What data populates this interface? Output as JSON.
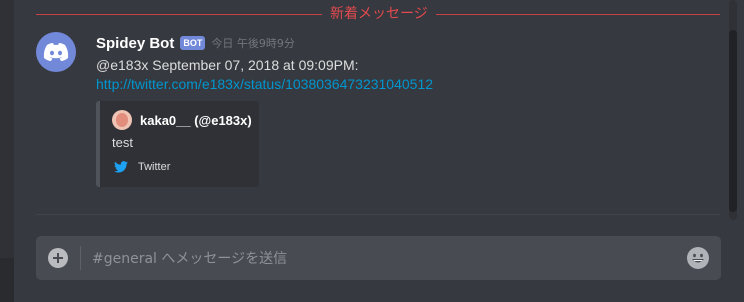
{
  "divider": {
    "label": "新着メッセージ"
  },
  "message": {
    "author": "Spidey Bot",
    "bot_tag": "BOT",
    "timestamp": "今日 午後9時9分",
    "text": "@e183x September 07, 2018 at 09:09PM:",
    "link": "http://twitter.com/e183x/status/1038036473231040512",
    "avatar_icon": "discord-logo-icon",
    "embed": {
      "author_name": "kaka0__ (@e183x)",
      "description": "test",
      "footer": "Twitter",
      "footer_icon": "twitter-bird-icon"
    }
  },
  "composer": {
    "placeholder": "#general へメッセージを送信",
    "add_icon": "plus-circle-icon",
    "emoji_icon": "emoji-icon"
  },
  "colors": {
    "background": "#36393f",
    "accent": "#7289da",
    "link": "#0096cf",
    "new_messages": "#e24a4f",
    "twitter": "#1da1f2"
  }
}
